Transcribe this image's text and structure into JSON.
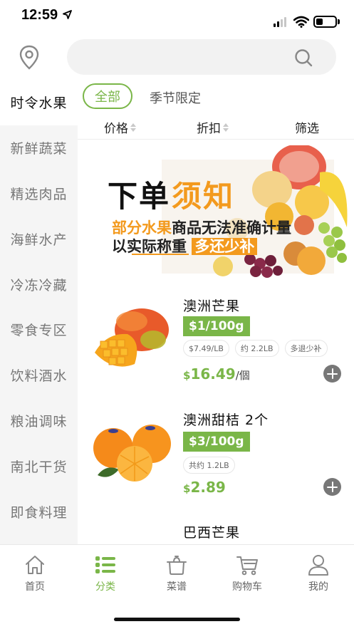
{
  "status_bar": {
    "time": "12:59"
  },
  "search": {
    "placeholder": "",
    "value": ""
  },
  "sidebar": {
    "items": [
      {
        "label": "时令水果",
        "active": true
      },
      {
        "label": "新鲜蔬菜"
      },
      {
        "label": "精选肉品"
      },
      {
        "label": "海鲜水产"
      },
      {
        "label": "冷冻冷藏"
      },
      {
        "label": "零食专区"
      },
      {
        "label": "饮料酒水"
      },
      {
        "label": "粮油调味"
      },
      {
        "label": "南北干货"
      },
      {
        "label": "即食料理"
      }
    ]
  },
  "sub_tabs": {
    "all": "全部",
    "seasonal": "季节限定"
  },
  "sort_bar": {
    "price": "价格",
    "discount": "折扣",
    "filter": "筛选"
  },
  "banner": {
    "title_part1": "下单",
    "title_part2": "须知",
    "line1_orange": "部分水果",
    "line1_rest": "商品无法准确计量",
    "line2_text": "以实际称重",
    "line2_pill": "多还少补"
  },
  "products": [
    {
      "name": "澳洲芒果",
      "unit_price": "$1/100g",
      "tags": [
        "$7.49/LB",
        "约 2.2LB",
        "多退少补"
      ],
      "currency": "$",
      "price": "16.49",
      "per": "/個"
    },
    {
      "name": "澳洲甜桔 2个",
      "unit_price": "$3/100g",
      "tags": [
        "共约 1.2LB"
      ],
      "currency": "$",
      "price": "2.89",
      "per": ""
    },
    {
      "name": "巴西芒果"
    }
  ],
  "tab_bar": {
    "items": [
      {
        "label": "首页",
        "icon": "home-icon"
      },
      {
        "label": "分类",
        "icon": "category-list-icon",
        "active": true
      },
      {
        "label": "菜谱",
        "icon": "pot-icon"
      },
      {
        "label": "购物车",
        "icon": "cart-icon"
      },
      {
        "label": "我的",
        "icon": "user-icon"
      }
    ]
  },
  "colors": {
    "accent": "#7ab648",
    "banner_orange": "#f39a1e",
    "sidebar_bg": "#f5f5f5"
  }
}
